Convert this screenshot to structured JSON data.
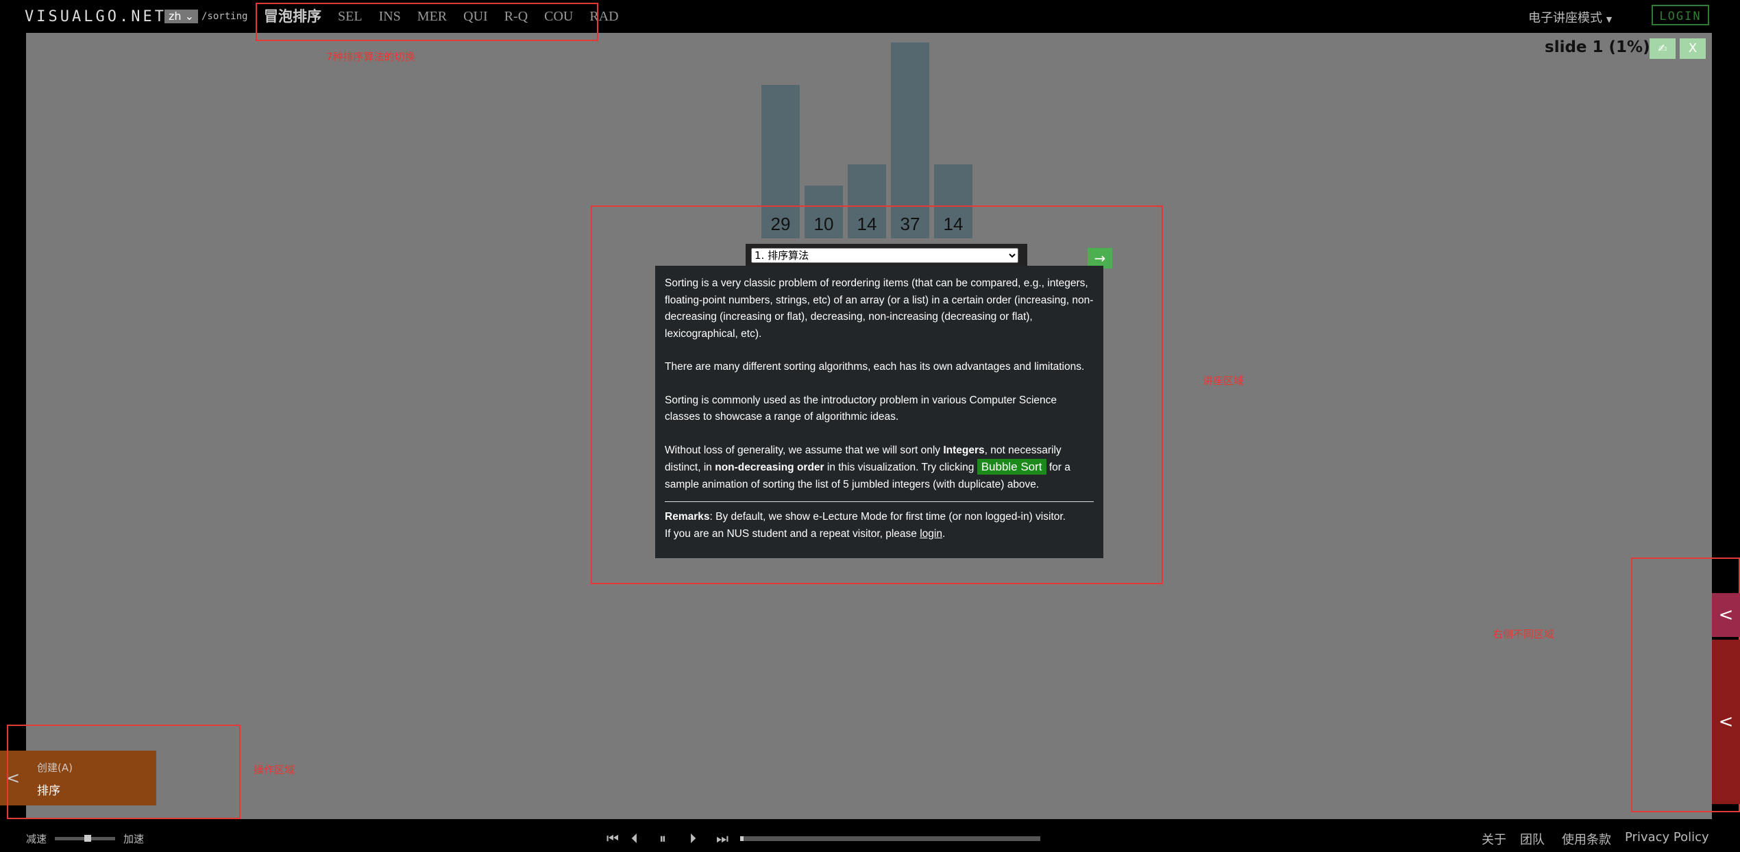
{
  "header": {
    "logo_text": "VISUALGO.NET",
    "lang": "zh",
    "path": "/sorting",
    "tabs": [
      {
        "label": "冒泡排序"
      },
      {
        "label": "SEL"
      },
      {
        "label": "INS"
      },
      {
        "label": "MER"
      },
      {
        "label": "QUI"
      },
      {
        "label": "R-Q"
      },
      {
        "label": "COU"
      },
      {
        "label": "RAD"
      }
    ],
    "mode_label": "电子讲座模式",
    "login_label": "LOGIN"
  },
  "slide": {
    "label": "slide 1 (1%)",
    "pen_icon": "✍",
    "close_label": "X"
  },
  "bars": {
    "values": [
      29,
      10,
      14,
      37,
      14
    ],
    "color": "#55686f"
  },
  "lecture": {
    "selected": "1. 排序算法",
    "next_label": "→",
    "p1": "Sorting is a very classic problem of reordering items (that can be compared, e.g., integers, floating-point numbers, strings, etc) of an array (or a list) in a certain order (increasing, non-decreasing (increasing or flat), decreasing, non-increasing (decreasing or flat), lexicographical, etc).",
    "p2": "There are many different sorting algorithms, each has its own advantages and limitations.",
    "p3": "Sorting is commonly used as the introductory problem in various Computer Science classes to showcase a range of algorithmic ideas.",
    "p4_a": "Without loss of generality, we assume that we will sort only ",
    "p4_b": "Integers",
    "p4_c": ", not necessarily distinct, in ",
    "p4_d": "non-decreasing order",
    "p4_e": " in this visualization. Try clicking ",
    "p4_btn": "Bubble Sort",
    "p4_f": " for a sample animation of sorting the list of 5 jumbled integers (with duplicate) above.",
    "remarks_b": "Remarks",
    "remarks_a": ": By default, we show e-Lecture Mode for first time (or non logged-in) visitor.",
    "remarks_c": "If you are an NUS student and a repeat visitor, please ",
    "remarks_link": "login",
    "remarks_end": "."
  },
  "annotations": {
    "top_label": "7种排序算法的切换",
    "center_label": "讲座区域",
    "right_label": "右侧不同区域",
    "left_label": "操作区域"
  },
  "action_panel": {
    "create": "创建(A)",
    "sort": "排序",
    "toggle": "<"
  },
  "right_tabs": {
    "tab1": "<",
    "tab2": "<"
  },
  "footer": {
    "speed_down": "减速",
    "speed_up": "加速",
    "speed_fraction": 0.55,
    "progress_fraction": 0.01,
    "links": [
      "关于",
      "团队",
      "使用条款",
      "Privacy Policy"
    ],
    "media": [
      "⏮",
      "⏴",
      "⏸",
      "⏵",
      "⏭"
    ]
  },
  "colors": {
    "accent_green": "#4caf50",
    "login_green": "#2e7d32",
    "annotation_red": "#e53935",
    "action_brown": "#8b4513"
  }
}
